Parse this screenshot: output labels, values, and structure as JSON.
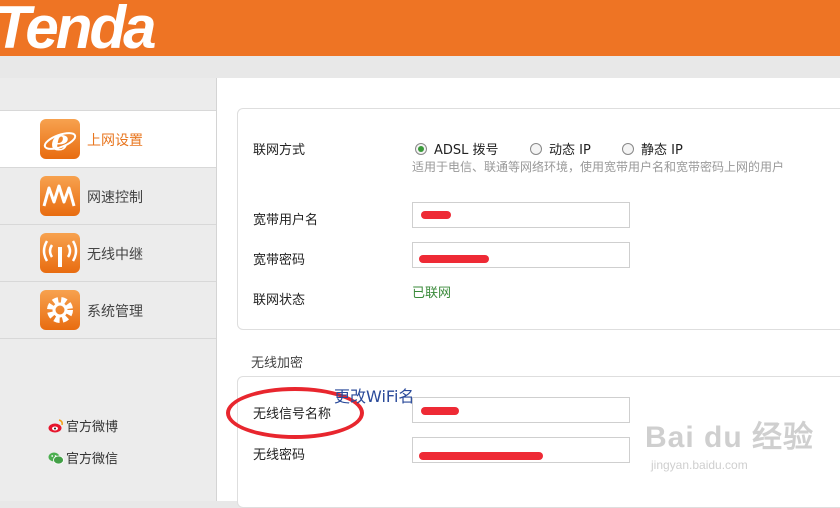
{
  "header": {
    "logo_text": "Tenda",
    "brand_color": "#ee7424"
  },
  "sidebar": {
    "items": [
      {
        "label": "上网设置",
        "icon": "internet-icon",
        "active": true
      },
      {
        "label": "网速控制",
        "icon": "speed-icon",
        "active": false
      },
      {
        "label": "无线中继",
        "icon": "wireless-relay-icon",
        "active": false
      },
      {
        "label": "系统管理",
        "icon": "gear-icon",
        "active": false
      }
    ],
    "social": [
      {
        "label": "官方微博",
        "icon": "weibo-icon"
      },
      {
        "label": "官方微信",
        "icon": "wechat-icon"
      }
    ]
  },
  "internet": {
    "mode_label": "联网方式",
    "modes": [
      {
        "label": "ADSL 拨号",
        "selected": true
      },
      {
        "label": "动态 IP",
        "selected": false
      },
      {
        "label": "静态 IP",
        "selected": false
      }
    ],
    "hint": "适用于电信、联通等网络环境，使用宽带用户名和宽带密码上网的用户",
    "username_label": "宽带用户名",
    "password_label": "宽带密码",
    "status_label": "联网状态",
    "status_value": "已联网"
  },
  "wireless": {
    "section_title": "无线加密",
    "ssid_label": "无线信号名称",
    "password_label": "无线密码"
  },
  "annotation": {
    "text": "更改WiFi名",
    "color": "#e8262e"
  },
  "watermark": {
    "main": "Bai du 经验",
    "sub": "jingyan.baidu.com"
  }
}
